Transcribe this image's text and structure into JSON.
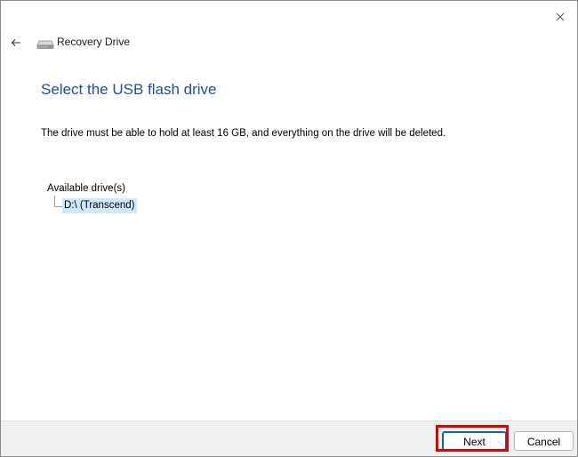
{
  "window": {
    "close_glyph": "×"
  },
  "titlebar": {
    "back_glyph": "←",
    "app_icon": "drive-icon",
    "title": "Recovery Drive"
  },
  "main": {
    "heading": "Select the USB flash drive",
    "description": "The drive must be able to hold at least 16 GB, and everything on the drive will be deleted.",
    "drive_list": {
      "label": "Available drive(s)",
      "items": [
        {
          "label": "D:\\ (Transcend)",
          "selected": true
        }
      ]
    }
  },
  "footer": {
    "next_label": "Next",
    "cancel_label": "Cancel"
  },
  "colors": {
    "heading": "#1f4e9c",
    "selection": "#cde8ff",
    "highlight_box": "#e00000",
    "primary_button_border": "#0067c0"
  }
}
